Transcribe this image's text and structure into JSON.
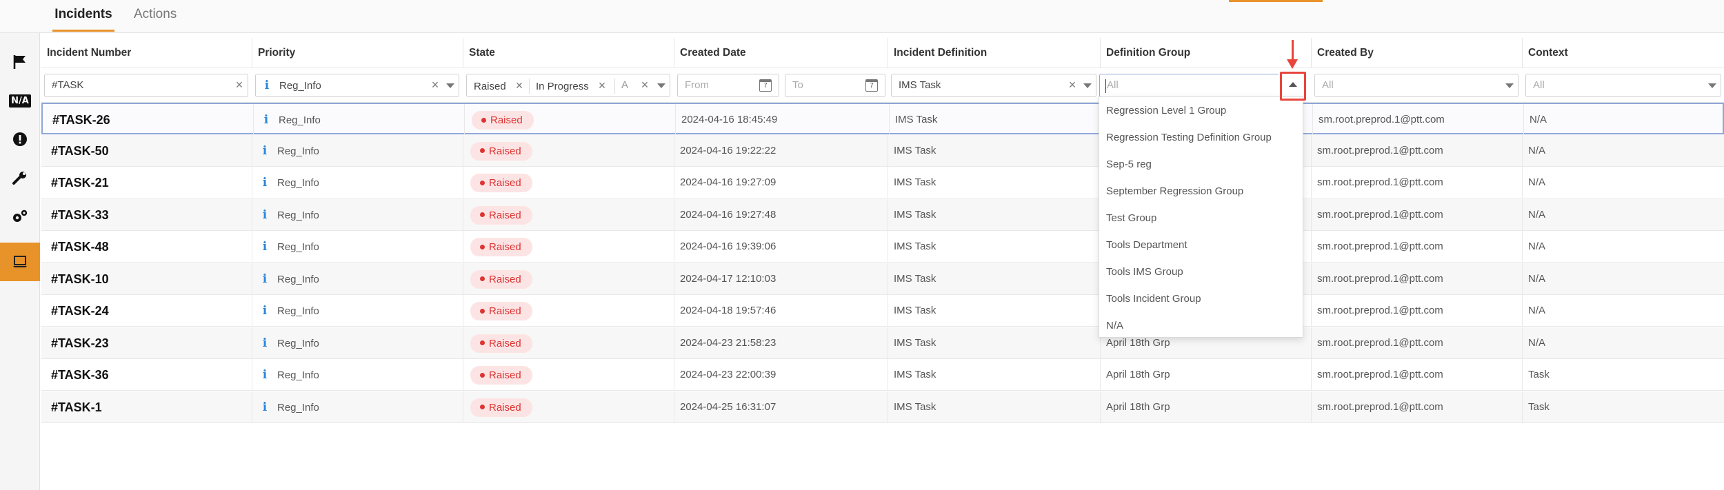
{
  "tabs": [
    {
      "label": "Incidents",
      "active": true
    },
    {
      "label": "Actions",
      "active": false
    }
  ],
  "rail_icons": [
    "flag-icon",
    "na-icon",
    "alert-icon",
    "wrench-icon",
    "gears-icon",
    "laptop-icon"
  ],
  "rail_na_text": "N/A",
  "columns": [
    "Incident Number",
    "Priority",
    "State",
    "Created Date",
    "Incident Definition",
    "Definition Group",
    "Created By",
    "Context"
  ],
  "filters": {
    "incident_number": "#TASK",
    "priority": "Reg_Info",
    "state_chips": [
      "Raised",
      "In Progress",
      "A"
    ],
    "date_from_placeholder": "From",
    "date_to_placeholder": "To",
    "calendar_day": "7",
    "incident_definition": "IMS Task",
    "definition_group_placeholder": "All",
    "created_by_placeholder": "All",
    "context_placeholder": "All"
  },
  "rows": [
    {
      "num": "#TASK-26",
      "priority": "Reg_Info",
      "state": "Raised",
      "date": "2024-04-16 18:45:49",
      "definition": "IMS Task",
      "group": "",
      "by": "sm.root.preprod.1@ptt.com",
      "context": "N/A"
    },
    {
      "num": "#TASK-50",
      "priority": "Reg_Info",
      "state": "Raised",
      "date": "2024-04-16 19:22:22",
      "definition": "IMS Task",
      "group": "",
      "by": "sm.root.preprod.1@ptt.com",
      "context": "N/A"
    },
    {
      "num": "#TASK-21",
      "priority": "Reg_Info",
      "state": "Raised",
      "date": "2024-04-16 19:27:09",
      "definition": "IMS Task",
      "group": "",
      "by": "sm.root.preprod.1@ptt.com",
      "context": "N/A"
    },
    {
      "num": "#TASK-33",
      "priority": "Reg_Info",
      "state": "Raised",
      "date": "2024-04-16 19:27:48",
      "definition": "IMS Task",
      "group": "",
      "by": "sm.root.preprod.1@ptt.com",
      "context": "N/A"
    },
    {
      "num": "#TASK-48",
      "priority": "Reg_Info",
      "state": "Raised",
      "date": "2024-04-16 19:39:06",
      "definition": "IMS Task",
      "group": "",
      "by": "sm.root.preprod.1@ptt.com",
      "context": "N/A"
    },
    {
      "num": "#TASK-10",
      "priority": "Reg_Info",
      "state": "Raised",
      "date": "2024-04-17 12:10:03",
      "definition": "IMS Task",
      "group": "",
      "by": "sm.root.preprod.1@ptt.com",
      "context": "N/A"
    },
    {
      "num": "#TASK-24",
      "priority": "Reg_Info",
      "state": "Raised",
      "date": "2024-04-18 19:57:46",
      "definition": "IMS Task",
      "group": "",
      "by": "sm.root.preprod.1@ptt.com",
      "context": "N/A"
    },
    {
      "num": "#TASK-23",
      "priority": "Reg_Info",
      "state": "Raised",
      "date": "2024-04-23 21:58:23",
      "definition": "IMS Task",
      "group": "April 18th Grp",
      "by": "sm.root.preprod.1@ptt.com",
      "context": "N/A"
    },
    {
      "num": "#TASK-36",
      "priority": "Reg_Info",
      "state": "Raised",
      "date": "2024-04-23 22:00:39",
      "definition": "IMS Task",
      "group": "April 18th Grp",
      "by": "sm.root.preprod.1@ptt.com",
      "context": "Task"
    },
    {
      "num": "#TASK-1",
      "priority": "Reg_Info",
      "state": "Raised",
      "date": "2024-04-25 16:31:07",
      "definition": "IMS Task",
      "group": "April 18th Grp",
      "by": "sm.root.preprod.1@ptt.com",
      "context": "Task"
    }
  ],
  "dropdown_options": [
    "Regression Level 1 Group",
    "Regression Testing Definition Group",
    "Sep-5 reg",
    "September Regression Group",
    "Test Group",
    "Tools Department",
    "Tools IMS Group",
    "Tools Incident Group",
    "N/A"
  ],
  "colors": {
    "accent": "#e8922a",
    "raised_bg": "#fde4e4",
    "raised_text": "#d33333",
    "info_blue": "#2a86d8",
    "highlight_red": "#e8453c"
  }
}
